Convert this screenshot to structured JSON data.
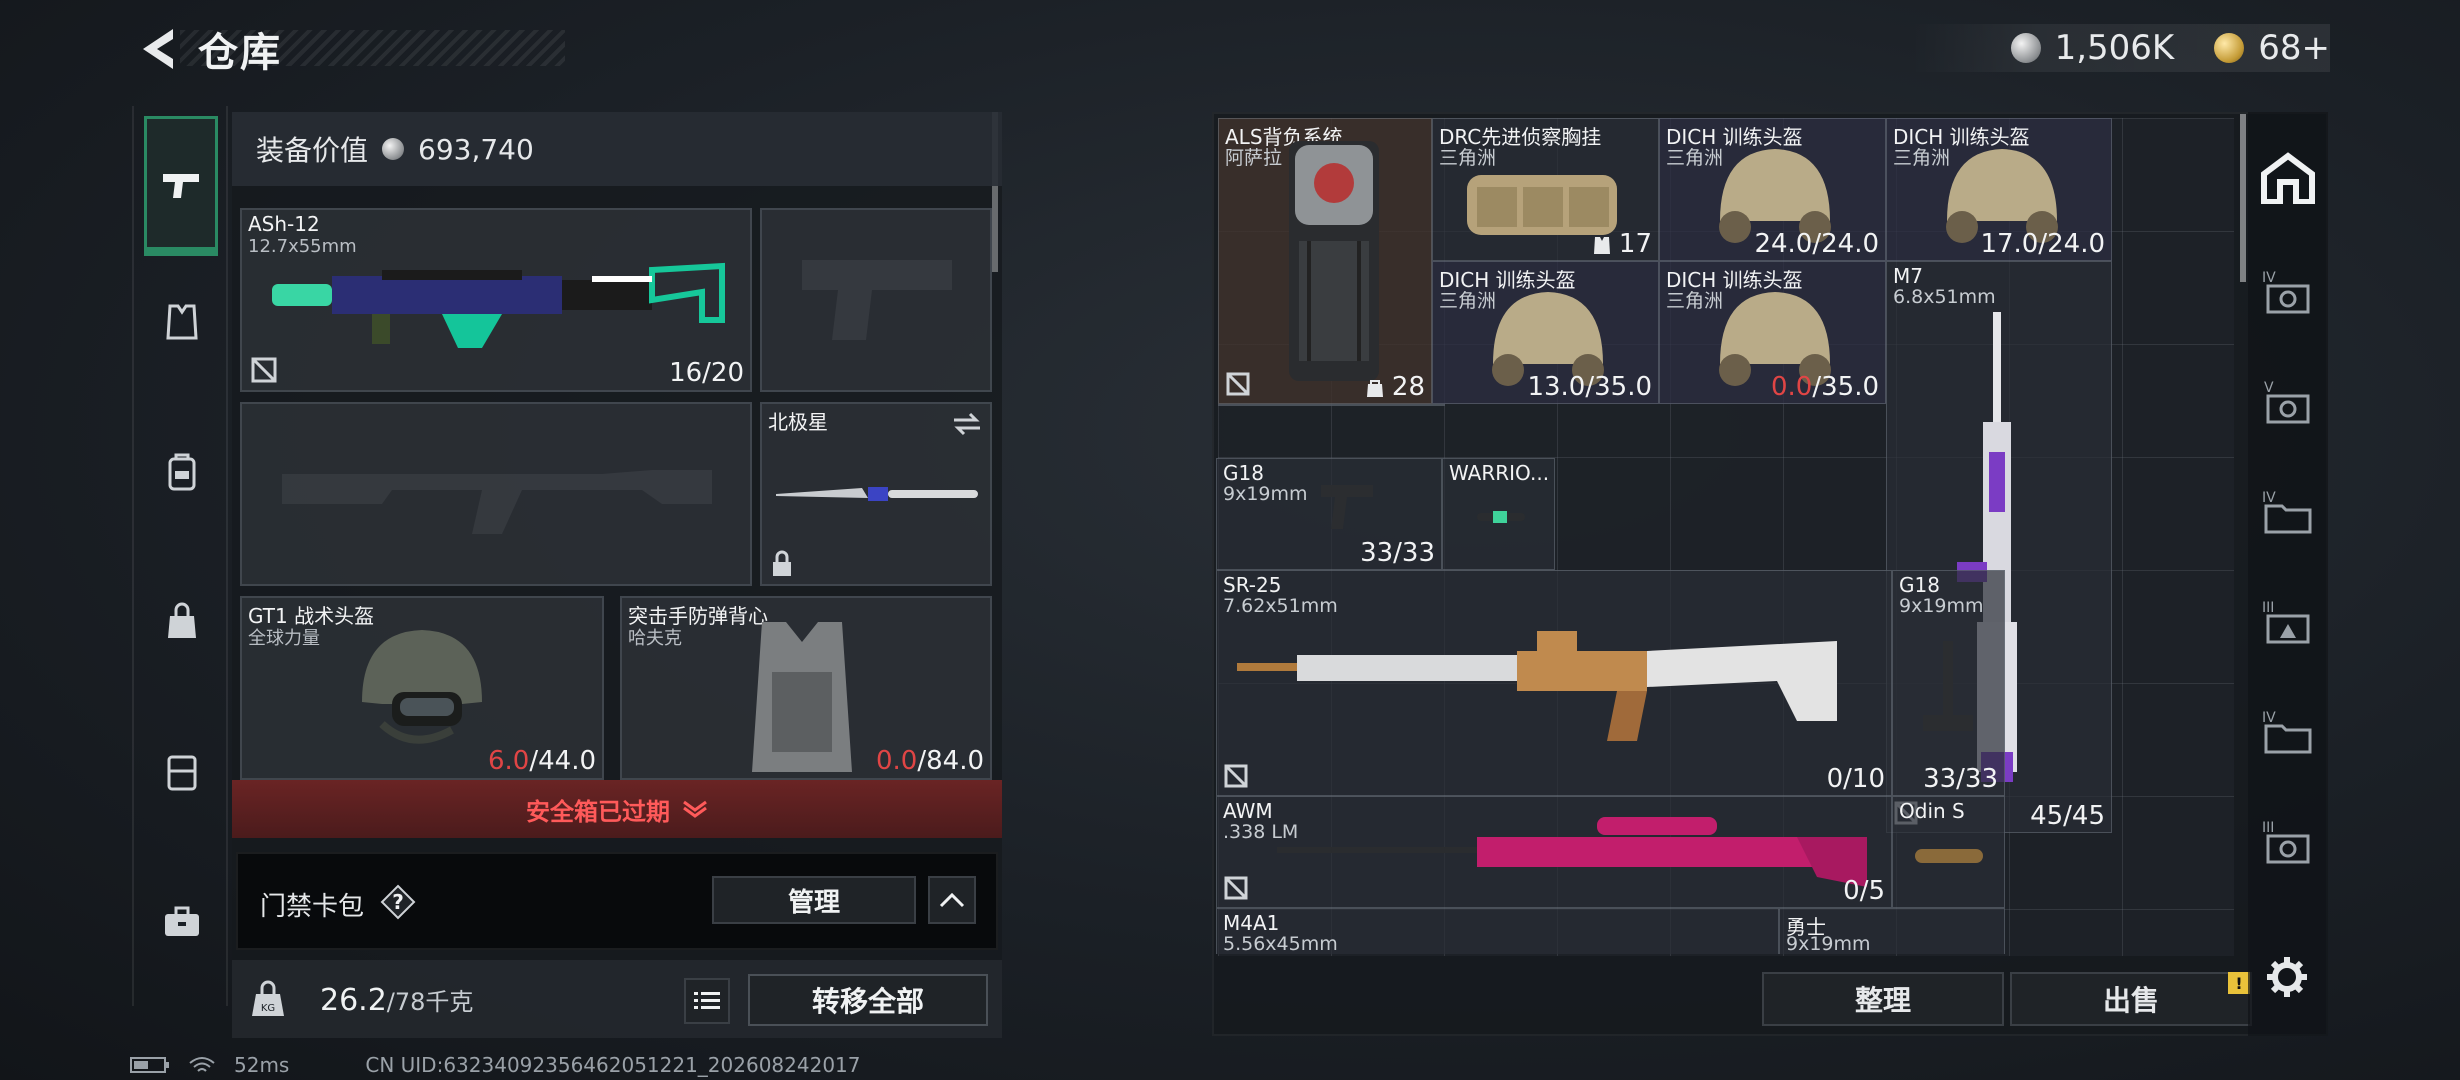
{
  "header": {
    "title": "仓库",
    "currency_silver": "1,506K",
    "currency_gold": "68+"
  },
  "left_panel": {
    "equip_value_label": "装备价值",
    "equip_value": "693,740",
    "slots": {
      "primary": {
        "name": "ASh-12",
        "caliber": "12.7x55mm",
        "ammo": "16/20"
      },
      "melee": {
        "name": "北极星"
      },
      "helmet": {
        "name": "GT1 战术头盔",
        "brand": "全球力量",
        "dur_cur": "6.0",
        "dur_max": "/44.0"
      },
      "armor": {
        "name": "突击手防弹背心",
        "brand": "哈夫克",
        "dur_cur": "0.0",
        "dur_max": "/84.0"
      }
    },
    "safebox_expired": "安全箱已过期",
    "keycard_label": "门禁卡包",
    "keycard_help": "?",
    "manage_button": "管理",
    "weight_current": "26.2",
    "weight_max": "/78千克",
    "transfer_button": "转移全部"
  },
  "stash": {
    "items": {
      "backpack": {
        "name": "ALS背负系统",
        "brand": "阿萨拉",
        "count": "28"
      },
      "chest_rig": {
        "name": "DRC先进侦察胸挂",
        "brand": "三角洲",
        "count": "17"
      },
      "helmet1": {
        "name": "DICH 训练头盔",
        "brand": "三角洲",
        "dur": "24.0/24.0"
      },
      "helmet2": {
        "name": "DICH 训练头盔",
        "brand": "三角洲",
        "dur": "17.0/24.0"
      },
      "helmet3": {
        "name": "DICH 训练头盔",
        "brand": "三角洲",
        "dur": "13.0/35.0"
      },
      "helmet4": {
        "name": "DICH 训练头盔",
        "brand": "三角洲",
        "dur_cur": "0.0",
        "dur_max": "/35.0"
      },
      "g18_a": {
        "name": "G18",
        "caliber": "9x19mm",
        "ammo": "33/33"
      },
      "warrior": {
        "name": "WARRIO..."
      },
      "m7": {
        "name": "M7",
        "caliber": "6.8x51mm",
        "ammo": "45/45"
      },
      "sr25": {
        "name": "SR-25",
        "caliber": "7.62x51mm",
        "ammo": "0/10"
      },
      "g18_b": {
        "name": "G18",
        "caliber": "9x19mm",
        "ammo": "33/33"
      },
      "awm": {
        "name": "AWM",
        "caliber": ".338 LM",
        "ammo": "0/5"
      },
      "odin": {
        "name": "Odin S"
      },
      "m4a1": {
        "name": "M4A1",
        "caliber": "5.56x45mm"
      },
      "warrior2": {
        "name": "勇士",
        "caliber": "9x19mm"
      }
    },
    "sort_button": "整理",
    "sell_button": "出售",
    "sell_badge": "!"
  },
  "status_bar": {
    "ping": "52ms",
    "uid": "CN UID:63234092356462051221_202608242017"
  },
  "colors": {
    "accent_green": "#2a8a63",
    "warning_red": "#e04545",
    "badge_yellow": "#e9c23a"
  }
}
